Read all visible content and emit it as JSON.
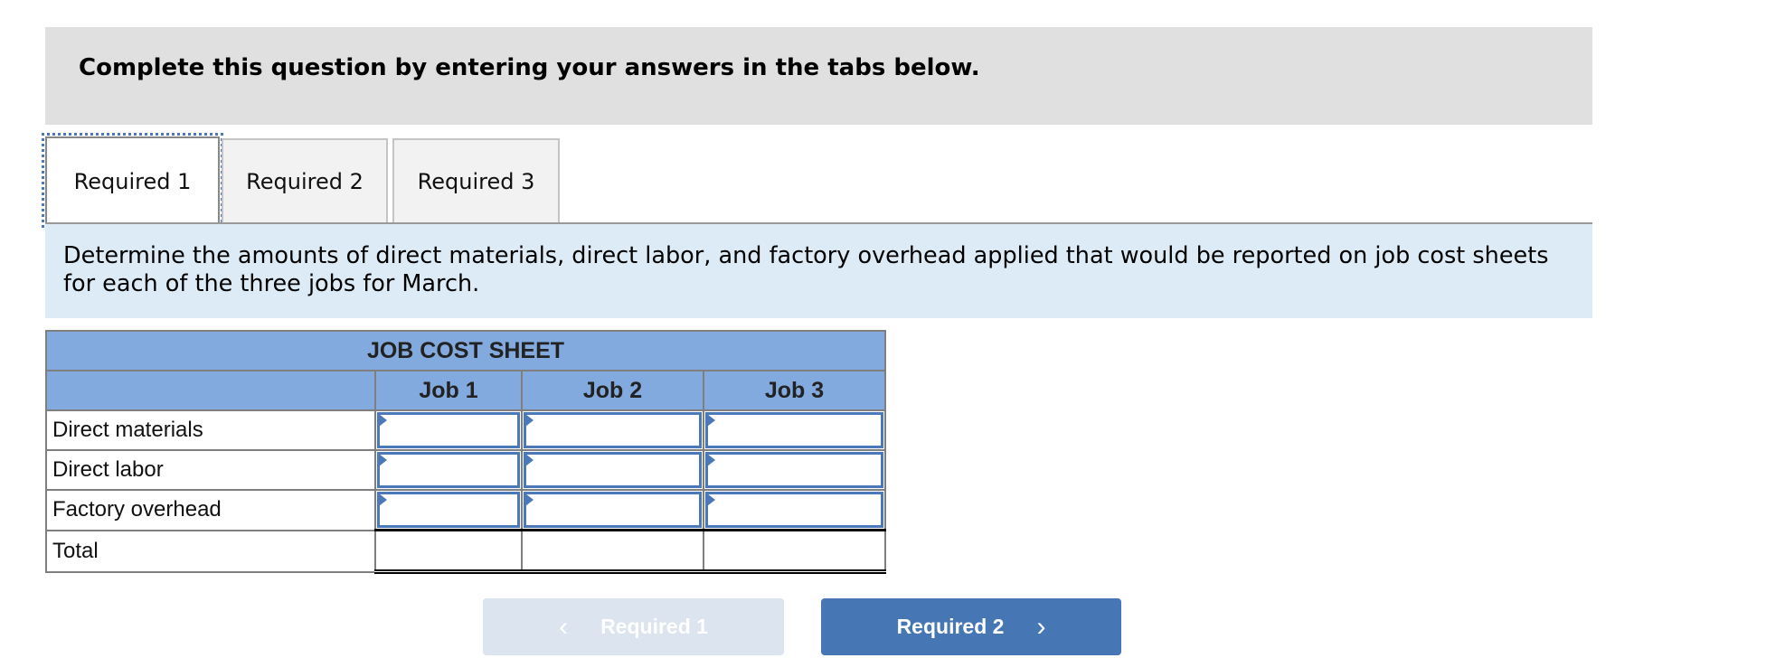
{
  "instructions": {
    "text": "Complete this question by entering your answers in the tabs below."
  },
  "tabs": [
    {
      "label": "Required 1",
      "active": true
    },
    {
      "label": "Required 2",
      "active": false
    },
    {
      "label": "Required 3",
      "active": false
    }
  ],
  "prompt": {
    "text": "Determine the amounts of direct materials, direct labor, and factory overhead applied that would be reported on job cost sheets for each of the three jobs for March."
  },
  "sheet": {
    "title": "JOB COST SHEET",
    "columns": [
      "Job 1",
      "Job 2",
      "Job 3"
    ],
    "rows": [
      {
        "label": "Direct materials",
        "values": [
          "",
          "",
          ""
        ]
      },
      {
        "label": "Direct labor",
        "values": [
          "",
          "",
          ""
        ]
      },
      {
        "label": "Factory overhead",
        "values": [
          "",
          "",
          ""
        ]
      },
      {
        "label": "Total",
        "values": [
          "",
          "",
          ""
        ]
      }
    ]
  },
  "nav": {
    "prev_label": "Required 1",
    "prev_icon": "chevron-left-icon",
    "prev_enabled": false,
    "next_label": "Required 2",
    "next_icon": "chevron-right-icon",
    "next_enabled": true
  },
  "colors": {
    "accent": "#4676b4",
    "header_fill": "#82aadf",
    "prompt_fill": "#ddebf7",
    "instructions_fill": "#e0e0e0"
  }
}
